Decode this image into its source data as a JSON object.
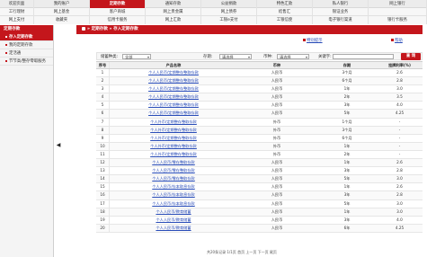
{
  "nav": {
    "row1": [
      "欢迎页面",
      "我的账户",
      "定期存款",
      "通知存款",
      "公益捐款",
      "特色汇款",
      "私人银行",
      "网上银行"
    ],
    "row2": [
      "工行理财",
      "网上基金",
      "客户商城",
      "网上贵金属",
      "网上债券",
      "结售汇",
      "银证业务",
      ""
    ],
    "row3": [
      "网上支付",
      "收藏夹",
      "信用卡服务",
      "网上汇款",
      "工银e支付",
      "工银信使",
      "电子银行渠道",
      "银行卡服务"
    ],
    "active_item": "定期存款"
  },
  "sidebar": {
    "title": "定期存款",
    "items": [
      {
        "label": "存入定期存款",
        "active": true
      },
      {
        "label": "我的定期存款",
        "active": false
      },
      {
        "label": "定活通",
        "active": false
      },
      {
        "label": "节节高/整存零取服务",
        "active": false
      }
    ]
  },
  "collapse_icon": "◀",
  "breadcrumb": "» 定期存款 » 存入定期存款",
  "actions": {
    "guide": "特别提示",
    "help": "帮助"
  },
  "filter": {
    "type_label": "储蓄种类:",
    "type_value": "全部",
    "term_label": "存期:",
    "term_value": "请选择",
    "currency_label": "币种:",
    "currency_value": "请选择",
    "keyword_label": "关键字:",
    "keyword_value": "",
    "search_button": "查 询"
  },
  "table": {
    "headers": [
      "序号",
      "产品名称",
      "币种",
      "存期",
      "挂牌利率(%)"
    ],
    "rows": [
      [
        "1",
        "个人人民币/定期整存整取存款",
        "人民币",
        "3个月",
        "2.6"
      ],
      [
        "2",
        "个人人民币/定期整存整取存款",
        "人民币",
        "6个月",
        "2.8"
      ],
      [
        "3",
        "个人人民币/定期整存整取存款",
        "人民币",
        "1年",
        "3.0"
      ],
      [
        "4",
        "个人人民币/定期整存整取存款",
        "人民币",
        "2年",
        "3.5"
      ],
      [
        "5",
        "个人人民币/定期整存整取存款",
        "人民币",
        "3年",
        "4.0"
      ],
      [
        "6",
        "个人人民币/定期整存整取存款",
        "人民币",
        "5年",
        "4.25"
      ],
      [
        "7",
        "个人外币/定期整存整取存款",
        "外币",
        "1个月",
        "-"
      ],
      [
        "8",
        "个人外币/定期整存整取存款",
        "外币",
        "3个月",
        "-"
      ],
      [
        "9",
        "个人外币/定期整存整取存款",
        "外币",
        "6个月",
        "-"
      ],
      [
        "10",
        "个人外币/定期整存整取存款",
        "外币",
        "1年",
        "-"
      ],
      [
        "11",
        "个人外币/定期整存整取存款",
        "外币",
        "2年",
        "-"
      ],
      [
        "12",
        "个人人民币/零存整取存款",
        "人民币",
        "1年",
        "2.6"
      ],
      [
        "13",
        "个人人民币/零存整取存款",
        "人民币",
        "3年",
        "2.8"
      ],
      [
        "14",
        "个人人民币/零存整取存款",
        "人民币",
        "5年",
        "3.0"
      ],
      [
        "15",
        "个人人民币/存本取息存款",
        "人民币",
        "1年",
        "2.6"
      ],
      [
        "16",
        "个人人民币/存本取息存款",
        "人民币",
        "3年",
        "2.8"
      ],
      [
        "17",
        "个人人民币/存本取息存款",
        "人民币",
        "5年",
        "3.0"
      ],
      [
        "18",
        "个人人民币/教育储蓄",
        "人民币",
        "1年",
        "3.0"
      ],
      [
        "19",
        "个人人民币/教育储蓄",
        "人民币",
        "3年",
        "4.0"
      ],
      [
        "20",
        "个人人民币/教育储蓄",
        "人民币",
        "6年",
        "4.25"
      ]
    ]
  },
  "footer": "共20条记录 1/1页 首页 上一页 下一页 尾页"
}
